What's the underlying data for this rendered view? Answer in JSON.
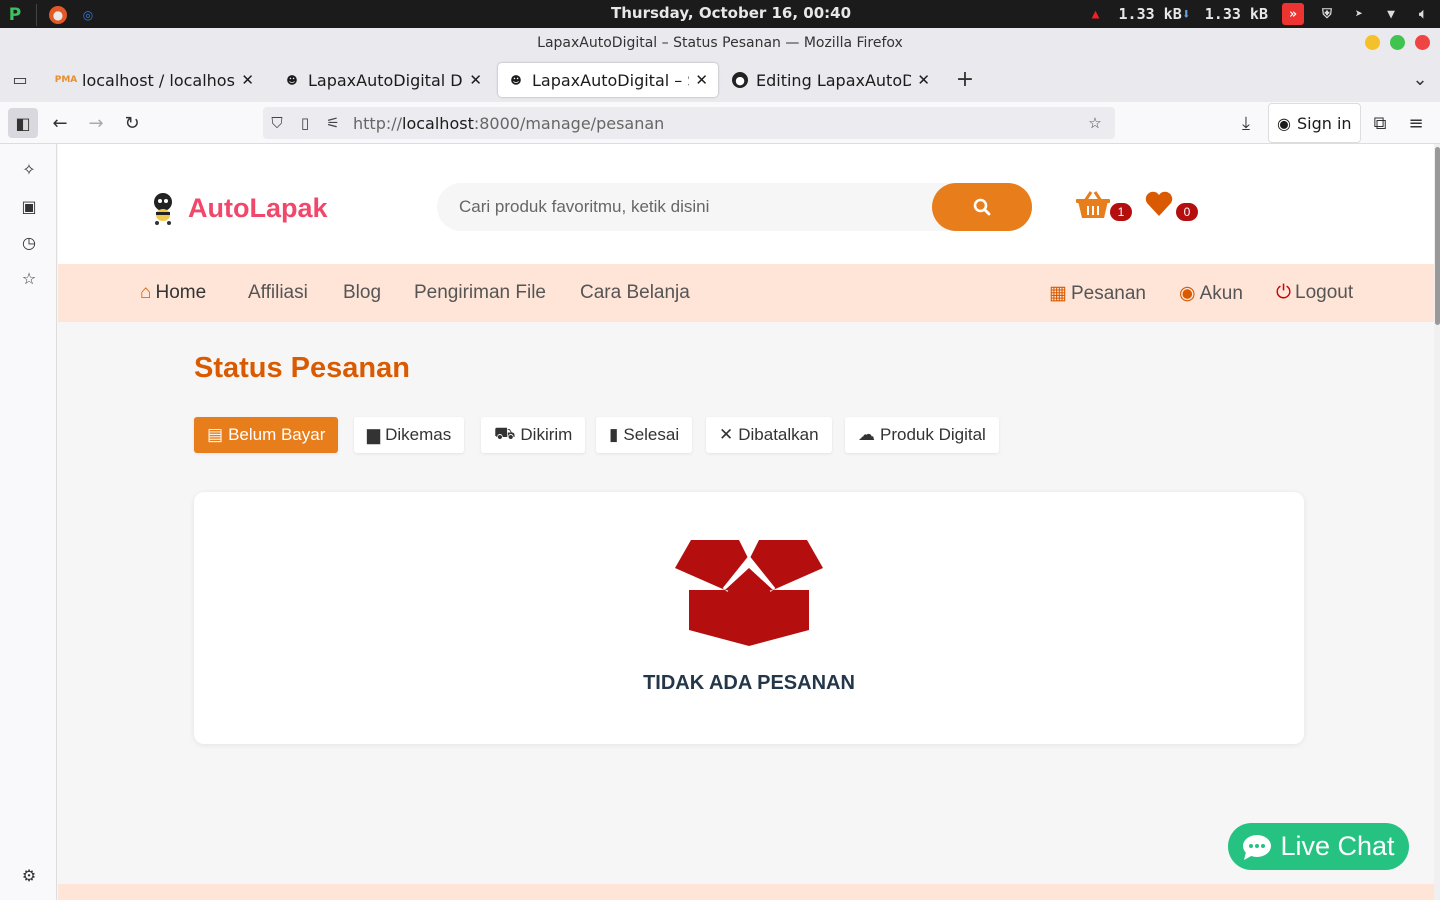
{
  "os": {
    "clock": "Thursday, October 16, 00:40",
    "net_down": "1.33 kB",
    "net_up": "1.33 kB"
  },
  "window": {
    "title": "LapaxAutoDigital – Status Pesanan — Mozilla Firefox"
  },
  "tabs": [
    {
      "label": "localhost / localhost / ",
      "icon": "phpmyadmin-icon"
    },
    {
      "label": "LapaxAutoDigital Dash",
      "icon": "mascot-icon"
    },
    {
      "label": "LapaxAutoDigital – Sta",
      "icon": "mascot-icon",
      "active": true
    },
    {
      "label": "Editing LapaxAutoDigi",
      "icon": "github-icon"
    }
  ],
  "navbar": {
    "url_prefix": "http://",
    "url_host": "localhost",
    "url_rest": ":8000/manage/pesanan",
    "sign_in": "Sign in"
  },
  "site": {
    "brand": "AutoLapak",
    "search_placeholder": "Cari produk favoritmu, ketik disini",
    "cart_count": "1",
    "wishlist_count": "0",
    "accent": "#e87d1b",
    "brand_color": "#f0476b"
  },
  "menu": {
    "home": "Home",
    "affiliasi": "Affiliasi",
    "blog": "Blog",
    "pengiriman": "Pengiriman File",
    "cara_belanja": "Cara Belanja",
    "pesanan": "Pesanan",
    "akun": "Akun",
    "logout": "Logout"
  },
  "main": {
    "title": "Status Pesanan",
    "filter_tabs": [
      "Belum Bayar",
      "Dikemas",
      "Dikirim",
      "Selesai",
      "Dibatalkan",
      "Produk Digital"
    ],
    "empty_message": "TIDAK ADA PESANAN"
  },
  "livechat": {
    "label": "Live Chat"
  }
}
